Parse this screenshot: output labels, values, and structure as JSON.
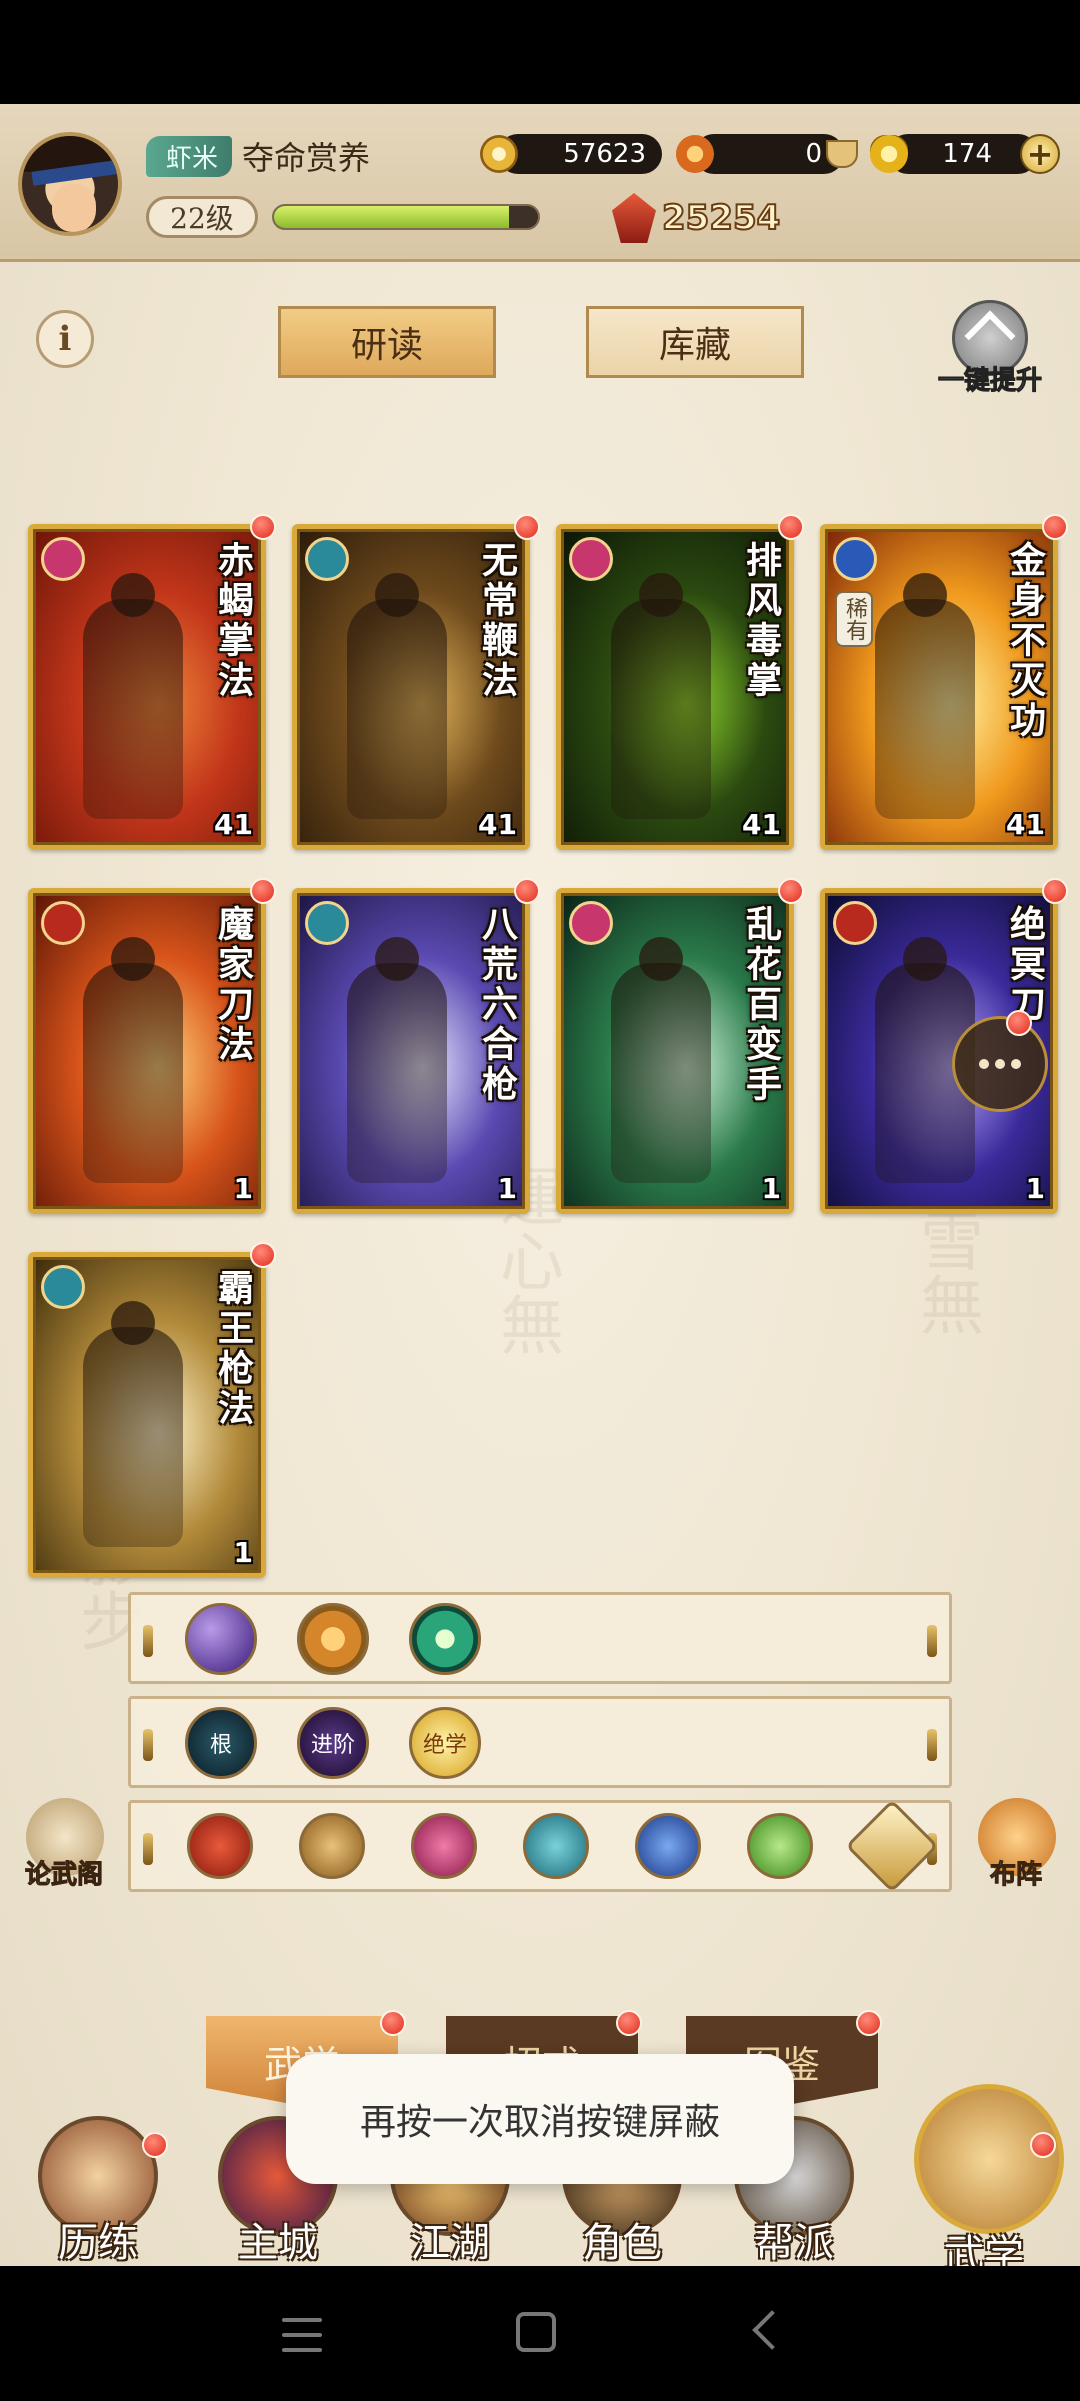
{
  "header": {
    "rank_badge": "虾米",
    "player_name": "夺命赏养",
    "level": "22级",
    "exp_fraction": 0.89,
    "silver": "57623",
    "fire_currency": "0",
    "ingot": "174",
    "power": "25254"
  },
  "top_tabs": {
    "study": "研读",
    "storage": "库藏"
  },
  "upgrade_label": "一键提升",
  "info_label": "i",
  "cards": [
    {
      "title": "赤蝎掌法",
      "level": "41",
      "school": "palm",
      "colors": [
        "#6b1408",
        "#c2361a",
        "#f0863a"
      ]
    },
    {
      "title": "无常鞭法",
      "level": "41",
      "school": "whip",
      "colors": [
        "#2a1a0a",
        "#6e4a1c",
        "#e2b45a"
      ]
    },
    {
      "title": "排风毒掌",
      "level": "41",
      "school": "palm",
      "colors": [
        "#0c1406",
        "#2b4a10",
        "#8cd22c"
      ]
    },
    {
      "title": "金身不灭功",
      "level": "41",
      "school": "internal",
      "rare": "稀有",
      "colors": [
        "#7a2206",
        "#f09a1e",
        "#fff1a0"
      ]
    },
    {
      "title": "魔家刀法",
      "level": "1",
      "school": "blade",
      "colors": [
        "#5a1406",
        "#d8541a",
        "#ffd27a"
      ]
    },
    {
      "title": "八荒六合枪",
      "level": "1",
      "school": "whip",
      "colors": [
        "#1c1440",
        "#5a4ab2",
        "#e8e6ff"
      ]
    },
    {
      "title": "乱花百变手",
      "level": "1",
      "school": "palm",
      "colors": [
        "#0a2016",
        "#2a7a4a",
        "#cdf2d8"
      ]
    },
    {
      "title": "绝冥刀",
      "level": "1",
      "school": "blade",
      "colors": [
        "#0a0a2a",
        "#3a2a9a",
        "#b8a8ff"
      ]
    },
    {
      "title": "霸王枪法",
      "level": "1",
      "school": "whip",
      "colors": [
        "#3a2a0a",
        "#b28a3a",
        "#fff3c8"
      ]
    }
  ],
  "stance_rows": {
    "row2_labels": [
      "根",
      "进阶",
      "绝学"
    ]
  },
  "side_buttons": {
    "left": "论武阁",
    "right": "布阵"
  },
  "lower_tabs": [
    "武学",
    "招式",
    "图鉴"
  ],
  "toast": "再按一次取消按键屏蔽",
  "nav": [
    "历练",
    "主城",
    "江湖",
    "角色",
    "帮派",
    "武学"
  ],
  "colors": {
    "school_palm": "#c8366e",
    "school_whip": "#2a8a9a",
    "school_internal": "#2a5ab8",
    "school_blade": "#b82a1e",
    "card_border": "#d9a93a"
  }
}
